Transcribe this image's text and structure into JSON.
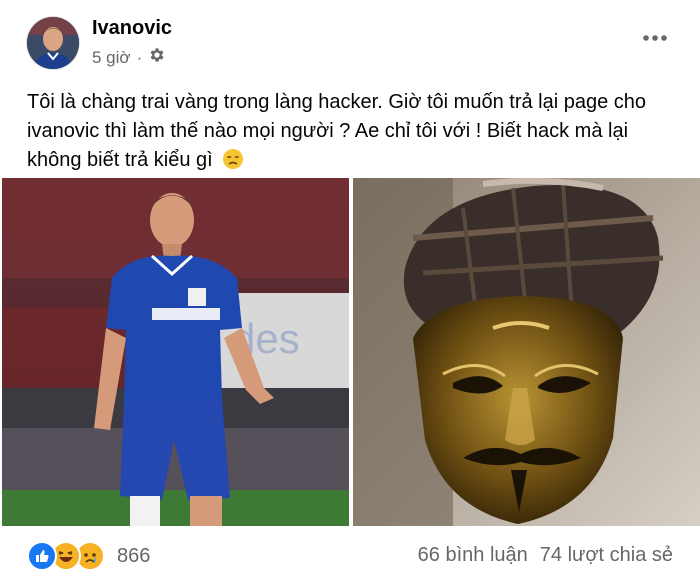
{
  "post": {
    "author": "Ivanovic",
    "time": "5 giờ",
    "separator": "·",
    "privacy_icon": "gear-icon",
    "more_icon": "ellipsis-icon",
    "text": "Tôi là chàng trai vàng trong làng hacker. Giờ tôi muốn trả lại page cho ivanovic thì làm thế nào mọi người ? Ae chỉ tôi với ! Biết hack mà lại không biết trả kiểu gì",
    "text_emoji": "disappointed-face-emoji"
  },
  "media": {
    "left_photo": "footballer-in-blue-kit-photo",
    "right_photo": "golden-mask-with-cap-photo"
  },
  "footer": {
    "reaction_icons": [
      "like-icon",
      "haha-icon",
      "sad-icon"
    ],
    "reaction_count": "866",
    "comments": "66 bình luận",
    "shares": "74 lượt chia sẻ"
  },
  "colors": {
    "text_primary": "#050505",
    "text_secondary": "#65676b",
    "like_blue": "#1877f2",
    "reaction_yellow": "#f7b125"
  }
}
